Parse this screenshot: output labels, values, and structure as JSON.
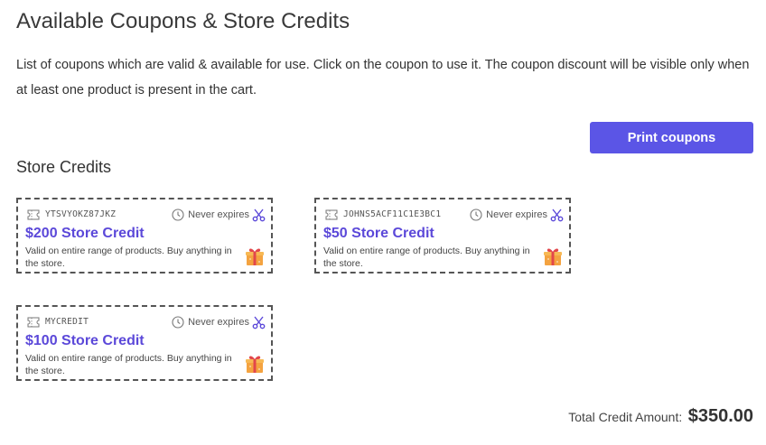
{
  "page": {
    "title": "Available Coupons & Store Credits",
    "description": "List of coupons which are valid & available for use. Click on the coupon to use it. The coupon discount will be visible only when at least one product is present in the cart."
  },
  "actions": {
    "print_label": "Print coupons"
  },
  "store_credits": {
    "heading": "Store Credits",
    "coupons": [
      {
        "code": "YTSVYOKZ87JKZ",
        "expiry": "Never expires",
        "title": "$200 Store Credit",
        "description": "Valid on entire range of products. Buy anything in the store."
      },
      {
        "code": "JOHNS5ACF11C1E3BC1",
        "expiry": "Never expires",
        "title": "$50 Store Credit",
        "description": "Valid on entire range of products. Buy anything in the store."
      },
      {
        "code": "MYCREDIT",
        "expiry": "Never expires",
        "title": "$100 Store Credit",
        "description": "Valid on entire range of products. Buy anything in the store."
      }
    ]
  },
  "total": {
    "label": "Total Credit Amount:",
    "value": "$350.00"
  },
  "colors": {
    "accent": "#5b55e6",
    "coupon_title": "#5b48d9",
    "border": "#555555"
  },
  "icons": {
    "code": "ticket-icon",
    "expiry": "clock-icon",
    "apply": "scissors-icon",
    "gift": "gift-icon"
  }
}
